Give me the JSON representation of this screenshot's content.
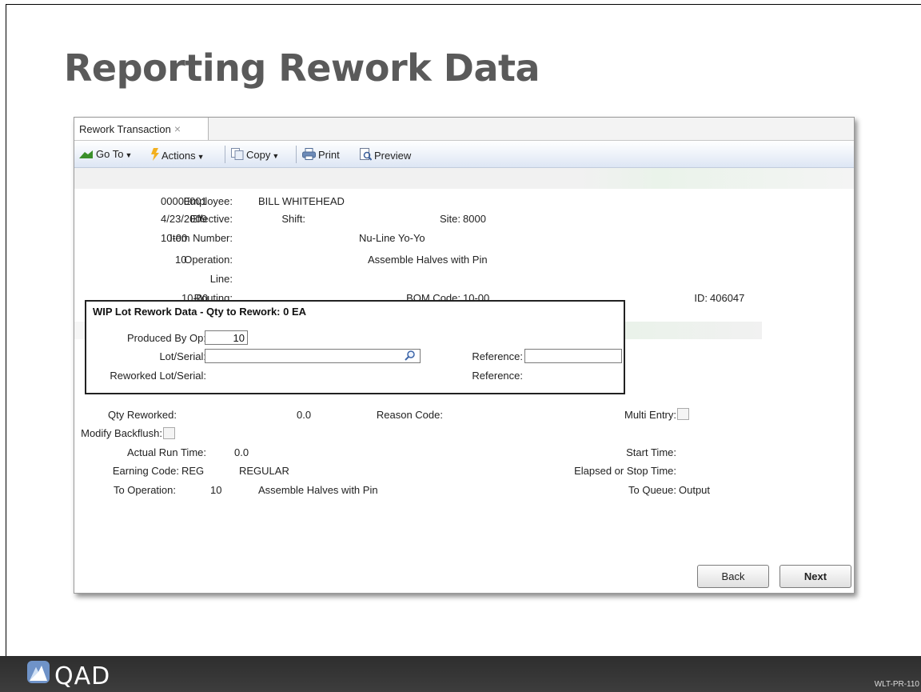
{
  "slide": {
    "title": "Reporting Rework Data",
    "code": "WLT-PR-110",
    "logo_text": "QAD"
  },
  "tab": {
    "label": "Rework Transaction",
    "close": "×"
  },
  "toolbar": {
    "goto": "Go To",
    "actions": "Actions",
    "copy": "Copy",
    "print": "Print",
    "preview": "Preview"
  },
  "header": {
    "employee_label": "Employee:",
    "employee_value": "00000001",
    "employee_name": "BILL WHITEHEAD",
    "effective_label": "Effective:",
    "effective_value": "4/23/2009",
    "shift_label": "Shift:",
    "site_label": "Site:",
    "site_value": "8000",
    "item_label": "Item Number:",
    "item_value": "10-00",
    "item_desc": "Nu-Line Yo-Yo",
    "operation_label": "Operation:",
    "operation_value": "10",
    "operation_desc": "Assemble Halves with Pin",
    "line_label": "Line:",
    "routing_label": "Routing:",
    "routing_value": "10-00",
    "bom_label": "BOM Code:",
    "bom_value": "10-00",
    "id_label": "ID:",
    "id_value": "406047"
  },
  "popup": {
    "title": "WIP Lot Rework Data - Qty to Rework: 0 EA",
    "produced_by_label": "Produced By Op:",
    "produced_by_value": "10",
    "lot_label": "Lot/Serial:",
    "lot_value": "",
    "reference_label": "Reference:",
    "reference_value": "",
    "reworked_label": "Reworked Lot/Serial:",
    "reference2_label": "Reference:"
  },
  "details": {
    "qty_label": "Qty Reworked:",
    "qty_value": "0.0",
    "reason_label": "Reason Code:",
    "multi_label": "Multi Entry:",
    "backflush_label": "Modify Backflush:",
    "run_label": "Actual Run Time:",
    "run_value": "0.0",
    "start_label": "Start Time:",
    "earning_label": "Earning Code:",
    "earning_value": "REG",
    "earning_desc": "REGULAR",
    "elapsed_label": "Elapsed or Stop Time:",
    "to_op_label": "To Operation:",
    "to_op_value": "10",
    "to_op_desc": "Assemble Halves with Pin",
    "to_queue_label": "To Queue:",
    "to_queue_value": "Output"
  },
  "buttons": {
    "back": "Back",
    "next": "Next"
  },
  "colors": {
    "footer": "#333333",
    "title": "#5a5a5a",
    "toolbar": "#dde6f4"
  }
}
